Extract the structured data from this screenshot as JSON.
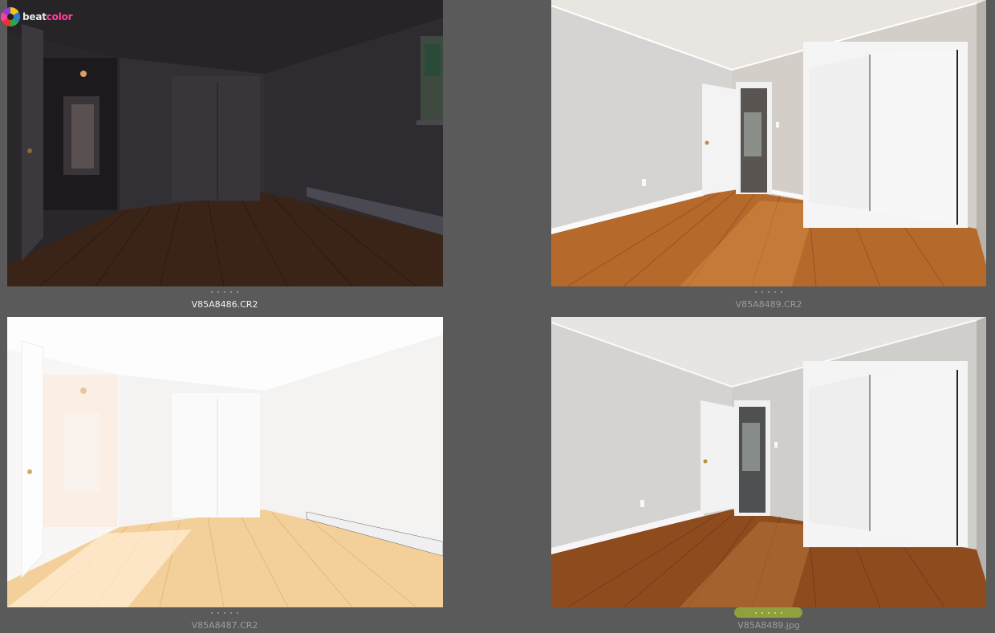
{
  "app": {
    "logo": {
      "icon": "color-wheel-icon",
      "word_1": "beat",
      "word_2": "color"
    }
  },
  "colors": {
    "background": "#5a5a5a",
    "rating_badge": "#8fa03c",
    "selected_filename": "#f2f2f2",
    "filename": "#9c9c9c"
  },
  "gallery": {
    "items": [
      {
        "filename": "V85A8486.CR2",
        "exposure": "dark",
        "selected": true,
        "rating_dots": 5,
        "rated": false
      },
      {
        "filename": "V85A8489.CR2",
        "exposure": "normal",
        "selected": false,
        "rating_dots": 5,
        "rated": false
      },
      {
        "filename": "V85A8487.CR2",
        "exposure": "overexposed",
        "selected": false,
        "rating_dots": 5,
        "rated": false
      },
      {
        "filename": "V85A8489.jpg",
        "exposure": "final",
        "selected": false,
        "rating_dots": 5,
        "rated": true
      }
    ]
  }
}
